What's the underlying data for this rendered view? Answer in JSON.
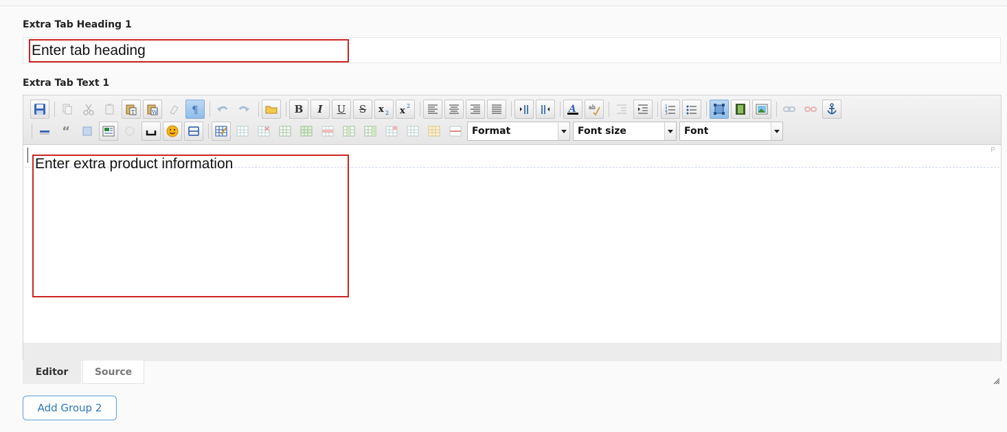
{
  "heading_field": {
    "label": "Extra Tab Heading 1",
    "placeholder": "Enter tab heading"
  },
  "text_field": {
    "label": "Extra Tab Text 1",
    "placeholder": "Enter extra product information",
    "block_tag": "P"
  },
  "toolbar": {
    "format_label": "Format",
    "font_size_label": "Font size",
    "font_label": "Font",
    "bold": "B",
    "italic": "I",
    "underline": "U",
    "strike": "S",
    "quote": "“"
  },
  "tabs": {
    "editor": "Editor",
    "source": "Source"
  },
  "actions": {
    "add_group": "Add Group 2"
  },
  "colors": {
    "highlight_border": "#cc2222",
    "button_accent": "#2a77bb"
  }
}
